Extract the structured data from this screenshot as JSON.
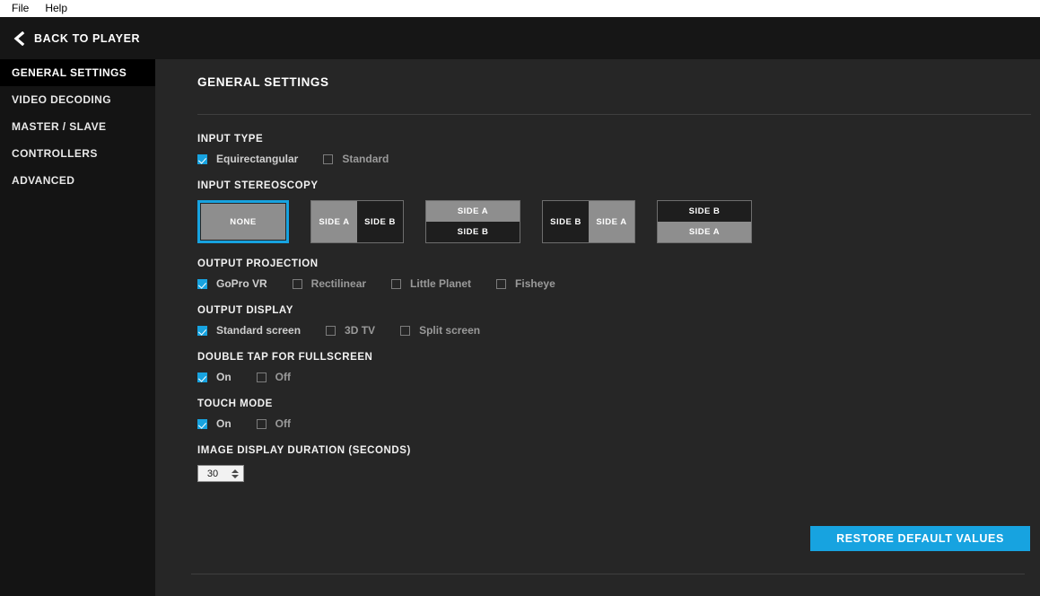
{
  "menubar": {
    "items": [
      {
        "label": "File"
      },
      {
        "label": "Help"
      }
    ]
  },
  "titlebar": {
    "back_label": "BACK TO PLAYER",
    "back_icon": "chevron-left-icon"
  },
  "sidebar": {
    "items": [
      {
        "label": "GENERAL SETTINGS",
        "active": true
      },
      {
        "label": "VIDEO DECODING",
        "active": false
      },
      {
        "label": "MASTER / SLAVE",
        "active": false
      },
      {
        "label": "CONTROLLERS",
        "active": false
      },
      {
        "label": "ADVANCED",
        "active": false
      }
    ]
  },
  "main": {
    "page_title": "GENERAL SETTINGS",
    "input_type": {
      "label": "INPUT TYPE",
      "options": [
        {
          "label": "Equirectangular",
          "checked": true
        },
        {
          "label": "Standard",
          "checked": false
        }
      ]
    },
    "input_stereoscopy": {
      "label": "INPUT STEREOSCOPY",
      "options": [
        {
          "name": "none",
          "selected": true,
          "layout": "single",
          "panes": [
            {
              "label": "NONE",
              "tone": "light"
            }
          ]
        },
        {
          "name": "side-a-side-b-horizontal",
          "selected": false,
          "layout": "horizontal",
          "panes": [
            {
              "label": "SIDE A",
              "tone": "light"
            },
            {
              "label": "SIDE B",
              "tone": "dark"
            }
          ]
        },
        {
          "name": "side-a-side-b-vertical",
          "selected": false,
          "layout": "vertical",
          "panes": [
            {
              "label": "SIDE A",
              "tone": "light"
            },
            {
              "label": "SIDE B",
              "tone": "dark"
            }
          ]
        },
        {
          "name": "side-b-side-a-horizontal",
          "selected": false,
          "layout": "horizontal",
          "panes": [
            {
              "label": "SIDE B",
              "tone": "dark"
            },
            {
              "label": "SIDE A",
              "tone": "light"
            }
          ]
        },
        {
          "name": "side-b-side-a-vertical",
          "selected": false,
          "layout": "vertical",
          "panes": [
            {
              "label": "SIDE B",
              "tone": "dark"
            },
            {
              "label": "SIDE A",
              "tone": "light"
            }
          ]
        }
      ]
    },
    "output_projection": {
      "label": "OUTPUT PROJECTION",
      "options": [
        {
          "label": "GoPro VR",
          "checked": true
        },
        {
          "label": "Rectilinear",
          "checked": false
        },
        {
          "label": "Little Planet",
          "checked": false
        },
        {
          "label": "Fisheye",
          "checked": false
        }
      ]
    },
    "output_display": {
      "label": "OUTPUT DISPLAY",
      "options": [
        {
          "label": "Standard screen",
          "checked": true
        },
        {
          "label": "3D TV",
          "checked": false
        },
        {
          "label": "Split screen",
          "checked": false
        }
      ]
    },
    "double_tap_fullscreen": {
      "label": "DOUBLE TAP FOR FULLSCREEN",
      "options": [
        {
          "label": "On",
          "checked": true
        },
        {
          "label": "Off",
          "checked": false
        }
      ]
    },
    "touch_mode": {
      "label": "TOUCH MODE",
      "options": [
        {
          "label": "On",
          "checked": true
        },
        {
          "label": "Off",
          "checked": false
        }
      ]
    },
    "image_display_duration": {
      "label": "IMAGE DISPLAY DURATION (SECONDS)",
      "value": "30"
    },
    "restore_button": {
      "label": "RESTORE DEFAULT VALUES"
    }
  },
  "colors": {
    "accent": "#17a3e0",
    "content_bg": "#262626",
    "sidebar_bg": "#141414",
    "titlebar_bg": "#161616",
    "pane_light": "#8e8e8e",
    "pane_dark": "#1e1e1e"
  }
}
